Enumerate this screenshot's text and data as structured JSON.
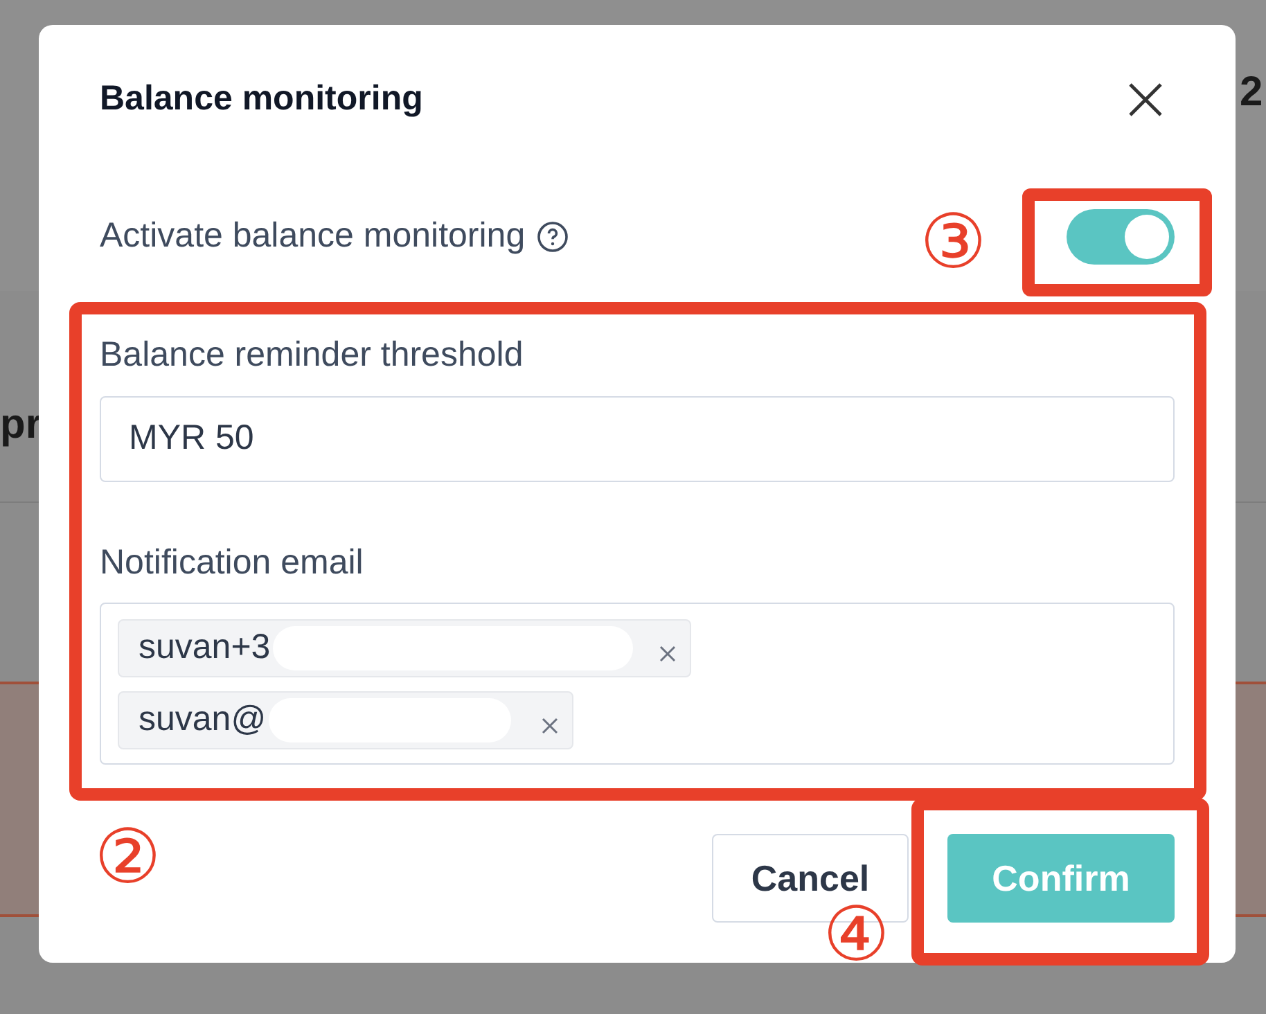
{
  "background": {
    "texts": [
      "2",
      "pr"
    ]
  },
  "dialog": {
    "title": "Balance monitoring",
    "toggle": {
      "label": "Activate balance monitoring",
      "on": true
    },
    "threshold": {
      "label": "Balance reminder threshold",
      "value": "MYR 50"
    },
    "email": {
      "label": "Notification email",
      "chips": [
        {
          "text": "suvan+3"
        },
        {
          "text": "suvan@"
        }
      ]
    },
    "buttons": [
      {
        "label": "Cancel",
        "kind": "secondary"
      },
      {
        "label": "Confirm",
        "kind": "primary"
      }
    ]
  },
  "annotations": [
    {
      "number": "③"
    },
    {
      "number": "②"
    },
    {
      "number": "④"
    }
  ]
}
